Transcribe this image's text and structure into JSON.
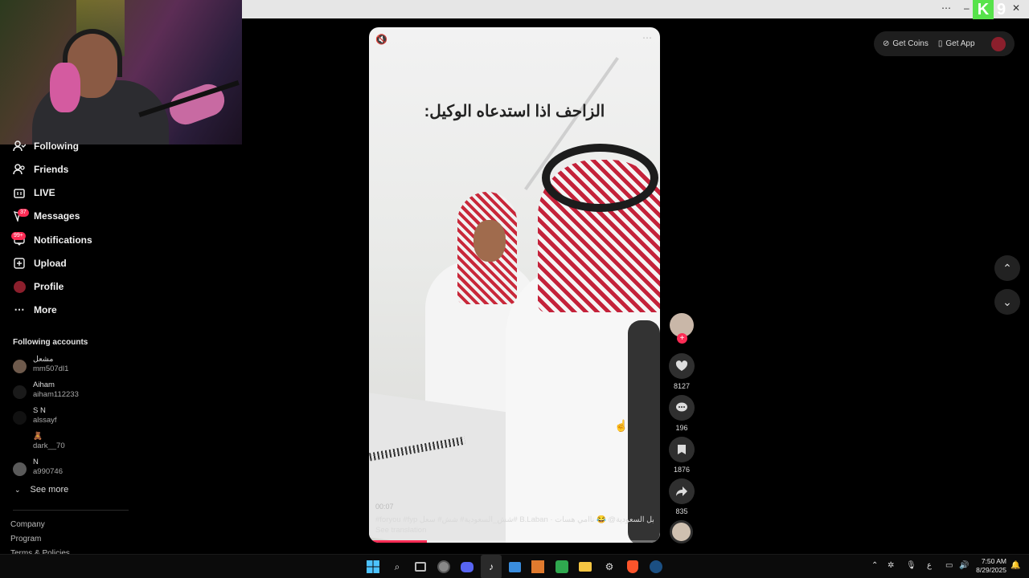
{
  "browser": {
    "overflow_label": "⋯",
    "minimize_label": "–",
    "restore_label": "▢",
    "close_label": "✕",
    "logo_k": "K",
    "logo_9": "9"
  },
  "sidebar": {
    "items": [
      {
        "label": "Following",
        "icon": "following-icon"
      },
      {
        "label": "Friends",
        "icon": "friends-icon"
      },
      {
        "label": "LIVE",
        "icon": "live-icon"
      },
      {
        "label": "Messages",
        "icon": "messages-icon",
        "badge": "37"
      },
      {
        "label": "Notifications",
        "icon": "notifications-icon",
        "badge": "99+"
      },
      {
        "label": "Upload",
        "icon": "upload-icon"
      },
      {
        "label": "Profile",
        "icon": "profile-avatar"
      },
      {
        "label": "More",
        "icon": "more-icon"
      }
    ],
    "following_title": "Following accounts",
    "accounts": [
      {
        "name": "مشعل",
        "handle": "mm507dl1"
      },
      {
        "name": "Aiham",
        "handle": "aiham112233"
      },
      {
        "name": "S N",
        "handle": "alssayf"
      },
      {
        "name": "🧸",
        "handle": "dark__70"
      },
      {
        "name": "N",
        "handle": "a990746"
      }
    ],
    "see_more": "See more",
    "footer": [
      "Company",
      "Program",
      "Terms & Policies"
    ]
  },
  "video": {
    "overlay_caption": "الزاحف اذا استدعاه الوكيل:",
    "time": "00:07",
    "description": "#foryou #fyp شش_السعودية# شش# سعل# B.Laban · سسبيل السعودية@ 😂 ناامي هسات",
    "see_translation": "See translation",
    "progress": 0.2
  },
  "actions": {
    "likes": "8127",
    "comments": "196",
    "saves": "1876",
    "shares": "835",
    "follow_plus": "+"
  },
  "topbar": {
    "get_coins": "Get Coins",
    "get_app": "Get App"
  },
  "taskbar": {
    "clock_time": "7:50 AM",
    "clock_date": "8/29/2025",
    "lang": "ع"
  }
}
